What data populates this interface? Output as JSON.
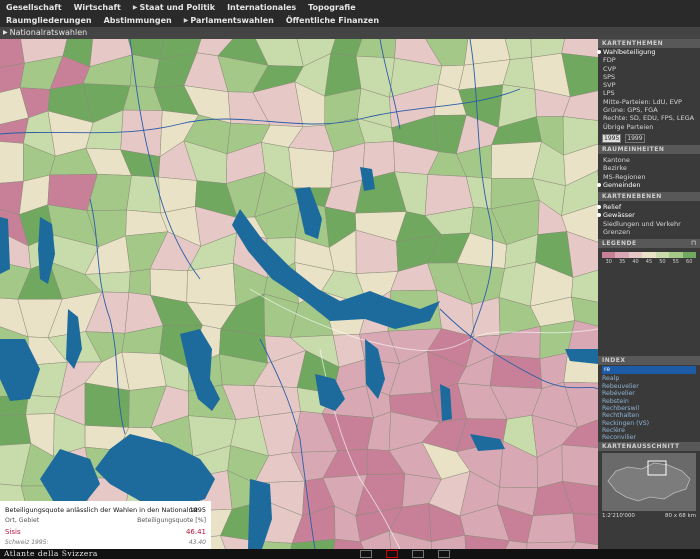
{
  "nav": {
    "row1": [
      {
        "label": "Gesellschaft",
        "arrow": false
      },
      {
        "label": "Wirtschaft",
        "arrow": false
      },
      {
        "label": "Staat und Politik",
        "arrow": true
      },
      {
        "label": "Internationales",
        "arrow": false
      },
      {
        "label": "Topografie",
        "arrow": false
      }
    ],
    "row2": [
      {
        "label": "Raumgliederungen",
        "arrow": false
      },
      {
        "label": "Abstimmungen",
        "arrow": false
      },
      {
        "label": "Parlamentswahlen",
        "arrow": true
      },
      {
        "label": "Öffentliche Finanzen",
        "arrow": false
      }
    ]
  },
  "breadcrumb": "Nationalratswahlen",
  "sidebar": {
    "kartenthemen": {
      "title": "KARTENTHEMEN",
      "items": [
        "Wahlbeteiligung",
        "FDP",
        "CVP",
        "SPS",
        "SVP",
        "LPS",
        "Mitte-Parteien: LdU, EVP",
        "Grüne: GPS, FGA",
        "Rechte: SD, EDU, FPS, LEGA",
        "Übrige Parteien"
      ],
      "active": 0
    },
    "years": [
      "1995",
      "1999"
    ],
    "selected_year": 0,
    "raumeinheiten": {
      "title": "RAUMEINHEITEN",
      "items": [
        "Kantone",
        "Bezirke",
        "MS-Regionen",
        "Gemeinden"
      ],
      "active": 3
    },
    "kartenebenen": {
      "title": "KARTENEBENEN",
      "items": [
        "Relief",
        "Gewässer",
        "Siedlungen und Verkehr",
        "Grenzen"
      ],
      "active": [
        0,
        1
      ]
    },
    "legende": {
      "title": "LEGENDE",
      "colors": [
        "#c78098",
        "#d8a8b4",
        "#e6c8c6",
        "#e9e2c6",
        "#c8dbaa",
        "#a3c888",
        "#6fa85e"
      ],
      "labels": [
        "30",
        "35",
        "40",
        "45",
        "50",
        "55",
        "60"
      ]
    },
    "index": {
      "title": "INDEX",
      "input_value": "re",
      "items": [
        "Realp",
        "Rebeuvelier",
        "Rebévelier",
        "Rebstein",
        "Rechberswil",
        "Rechthalten",
        "Reckingen (VS)",
        "Reclère",
        "Reconvilier"
      ]
    },
    "kartenausschnitt": {
      "title": "KARTENAUSSCHNITT",
      "scale": "1:2'210'000",
      "size": "80 x 68 km"
    }
  },
  "infobox": {
    "title": "Beteiligungsquote anlässlich der Wahlen in den Nationalrat",
    "year": "1995",
    "header_left": "Ort, Gebiet",
    "header_right": "Beteiligungsquote [%]",
    "place": "Sisis",
    "value": "46.41",
    "avg_label": "Schweiz 1995:",
    "avg_value": "43.40"
  },
  "brand": "Atlante della Svizzera",
  "colors": {
    "lake": "#1c6b9c",
    "river": "#2a5ea8",
    "border": "#6e6e5e"
  }
}
